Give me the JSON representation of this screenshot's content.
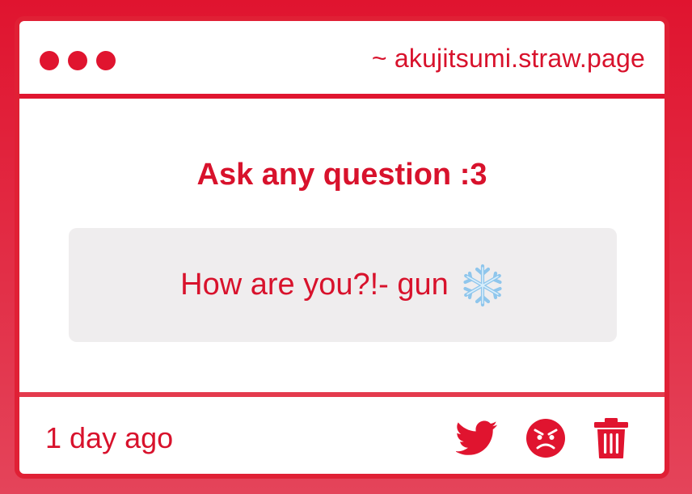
{
  "window": {
    "url": "~ akujitsumi.straw.page"
  },
  "main": {
    "title": "Ask any question :3",
    "question": "How are you?!- gun",
    "question_emoji": "snowflake-icon"
  },
  "footer": {
    "time": "1 day ago",
    "actions": [
      "twitter-icon",
      "angry-face-icon",
      "trash-icon"
    ]
  },
  "colors": {
    "accent": "#e0142f",
    "question_bg": "#efedee",
    "card_bg": "#ffffff"
  }
}
